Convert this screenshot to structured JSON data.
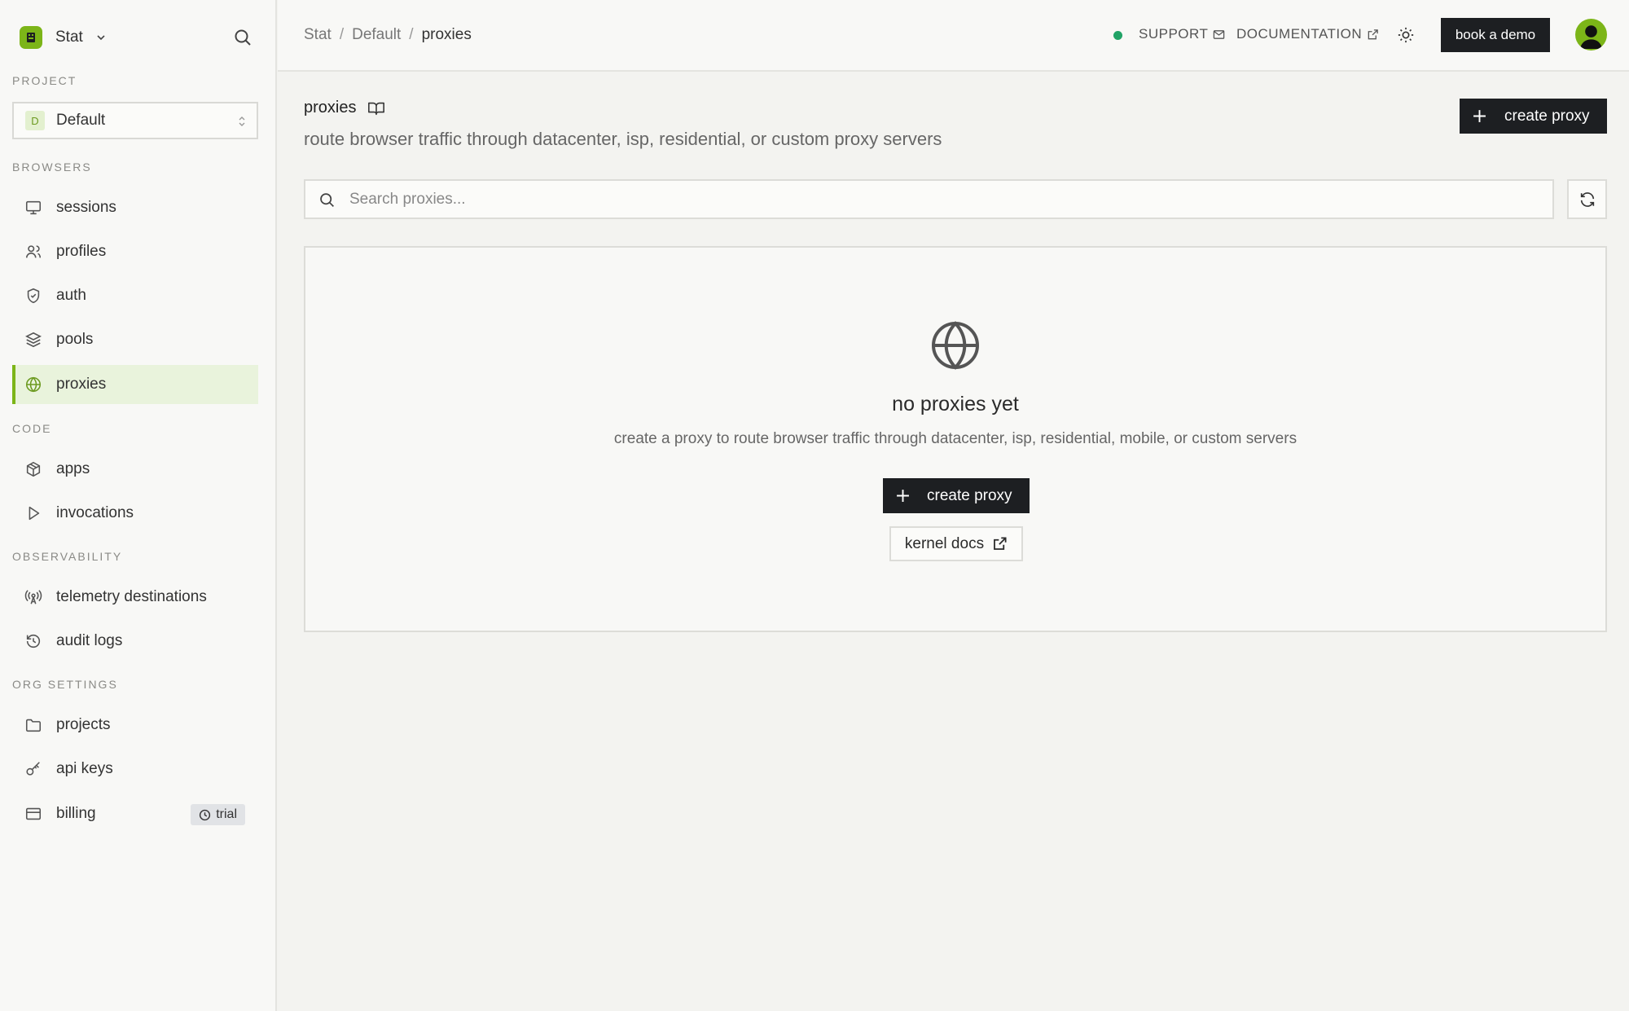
{
  "sidebar": {
    "org_name": "Stat",
    "sections": {
      "project": "PROJECT",
      "browsers": "BROWSERS",
      "code": "CODE",
      "observability": "OBSERVABILITY",
      "org_settings": "ORG SETTINGS"
    },
    "project_select": {
      "badge": "D",
      "value": "Default"
    },
    "items": [
      {
        "label": "sessions",
        "icon": "monitor-icon"
      },
      {
        "label": "profiles",
        "icon": "users-icon"
      },
      {
        "label": "auth",
        "icon": "shield-check-icon"
      },
      {
        "label": "pools",
        "icon": "layers-icon"
      },
      {
        "label": "proxies",
        "icon": "globe-icon",
        "active": true
      },
      {
        "label": "apps",
        "icon": "package-icon"
      },
      {
        "label": "invocations",
        "icon": "play-icon"
      },
      {
        "label": "telemetry destinations",
        "icon": "radio-tower-icon"
      },
      {
        "label": "audit logs",
        "icon": "history-icon"
      },
      {
        "label": "projects",
        "icon": "folder-icon"
      },
      {
        "label": "api keys",
        "icon": "key-icon"
      },
      {
        "label": "billing",
        "icon": "credit-card-icon"
      }
    ],
    "billing_badge": "trial"
  },
  "topbar": {
    "breadcrumb": [
      "Stat",
      "Default",
      "proxies"
    ],
    "breadcrumb_sep": "/",
    "support": "SUPPORT",
    "documentation": "DOCUMENTATION",
    "demo": "book a demo",
    "status_color": "#21a366"
  },
  "main": {
    "title": "proxies",
    "description": "route browser traffic through datacenter, isp, residential, or custom proxy servers",
    "create_label": "create proxy",
    "search_placeholder": "Search proxies...",
    "empty": {
      "title": "no proxies yet",
      "description": "create a proxy to route browser traffic through datacenter, isp, residential, mobile, or custom servers",
      "create_label": "create proxy",
      "docs_label": "kernel docs"
    }
  },
  "colors": {
    "accent": "#7cb518",
    "dark_button": "#1d1f22"
  }
}
